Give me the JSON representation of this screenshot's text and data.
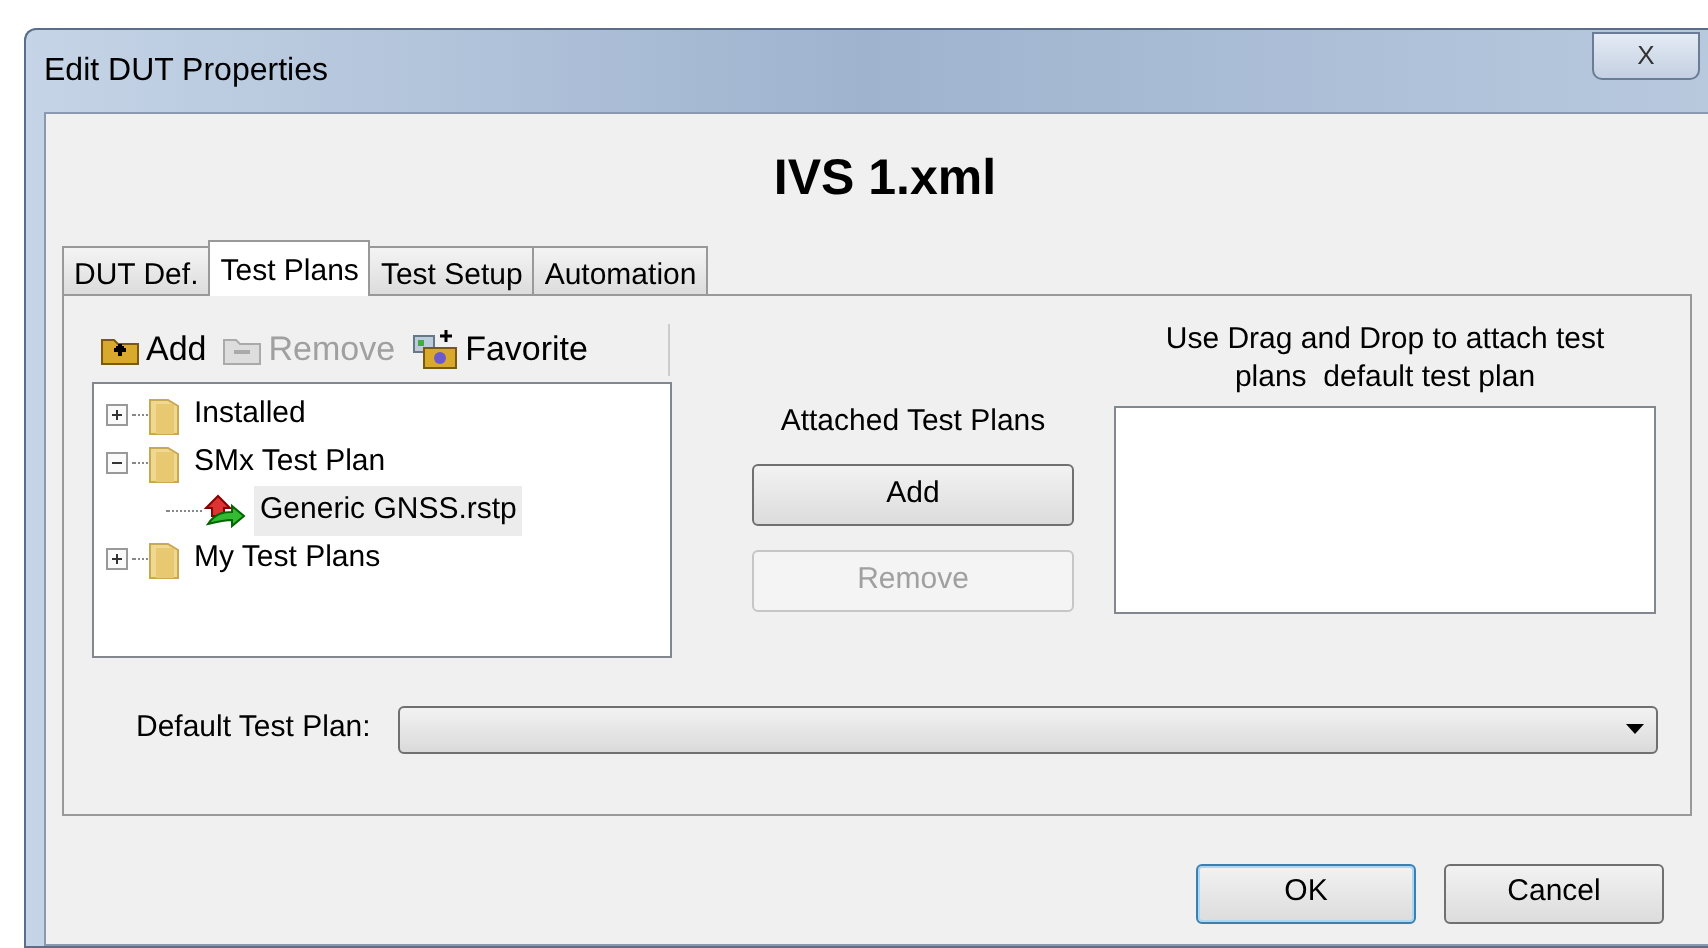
{
  "window": {
    "title": "Edit DUT Properties",
    "close": "X"
  },
  "heading": "IVS 1.xml",
  "tabs": [
    {
      "label": "DUT Def.",
      "selected": false
    },
    {
      "label": "Test Plans",
      "selected": true
    },
    {
      "label": "Test Setup",
      "selected": false
    },
    {
      "label": "Automation",
      "selected": false
    }
  ],
  "toolbar": [
    {
      "label": "Add",
      "kind": "add",
      "disabled": false
    },
    {
      "label": "Remove",
      "kind": "remove",
      "disabled": true
    },
    {
      "label": "Favorite",
      "kind": "favorite",
      "disabled": false
    }
  ],
  "tree": [
    {
      "label": "Installed",
      "kind": "folder",
      "expanded": false,
      "selected": false
    },
    {
      "label": "SMx Test Plan",
      "kind": "folder",
      "expanded": true,
      "selected": false,
      "children": [
        {
          "label": "Generic GNSS.rstp",
          "kind": "plan",
          "selected": true
        }
      ]
    },
    {
      "label": "My Test Plans",
      "kind": "folder",
      "expanded": false,
      "selected": false
    }
  ],
  "attached": {
    "label": "Attached Test Plans",
    "buttons": [
      {
        "label": "Add",
        "disabled": false
      },
      {
        "label": "Remove",
        "disabled": true
      }
    ]
  },
  "drop_hint": "Use Drag and Drop to attach test plans  default test plan",
  "default_plan": {
    "label": "Default Test Plan:"
  },
  "buttons": [
    {
      "label": "OK",
      "default": true
    },
    {
      "label": "Cancel",
      "default": false
    }
  ]
}
